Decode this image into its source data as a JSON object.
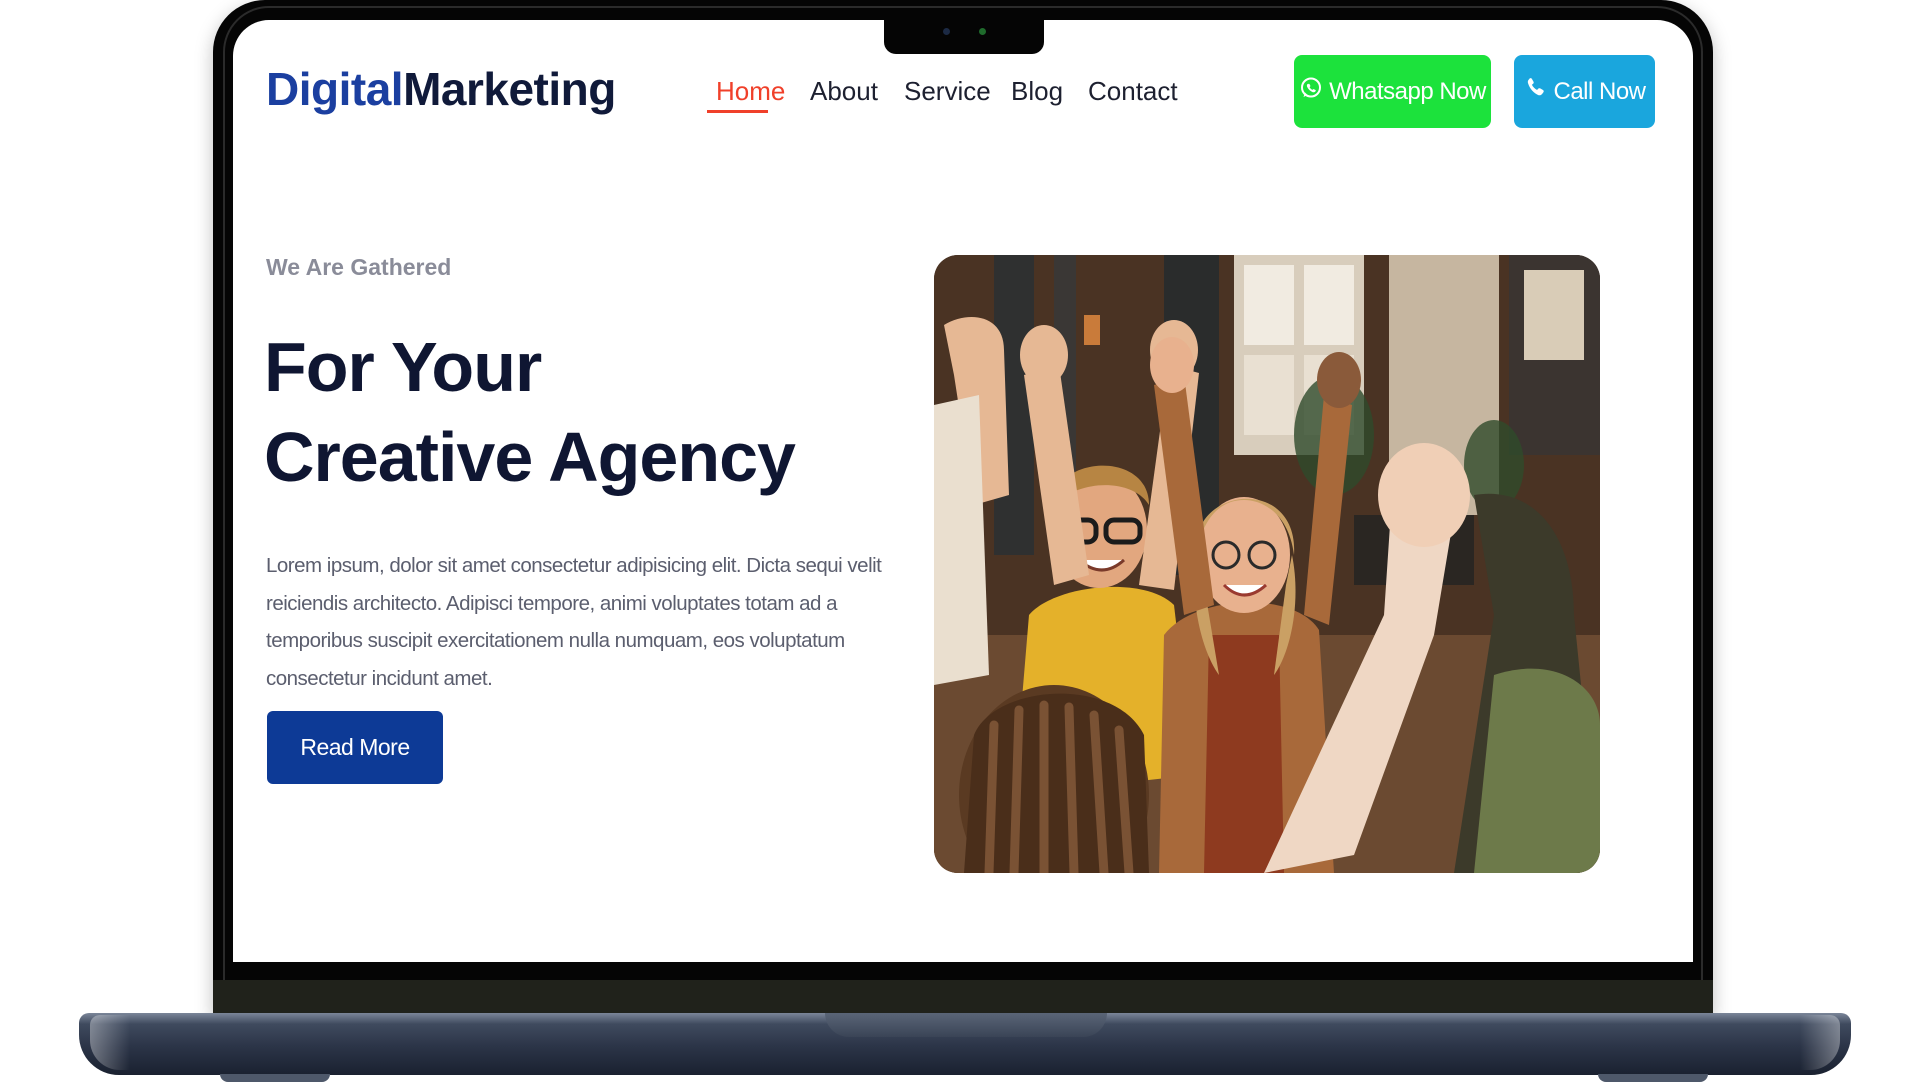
{
  "brand": {
    "part1": "Digital",
    "part2": "Marketing"
  },
  "nav": {
    "items": [
      "Home",
      "About",
      "Service",
      "Blog",
      "Contact"
    ],
    "active": "Home"
  },
  "actions": {
    "whatsapp_label": "Whatsapp Now",
    "call_label": "Call Now"
  },
  "hero": {
    "eyebrow": "We Are Gathered",
    "title_line1": "For Your",
    "title_line2": "Creative Agency",
    "body": "Lorem ipsum, dolor sit amet consectetur adipisicing elit. Dicta sequi velit reiciendis architecto. Adipisci tempore, animi voluptates totam ad a temporibus suscipit exercitationem nulla numquam, eos voluptatum consectetur incidunt amet.",
    "cta_label": "Read More"
  },
  "colors": {
    "accent_nav": "#f0402a",
    "brand_blue": "#1b3fa0",
    "brand_dark": "#101a3a",
    "whatsapp_green": "#1ce23c",
    "call_blue": "#1aa6dd",
    "cta_blue": "#0d3a96"
  },
  "icons": {
    "whatsapp": "whatsapp-icon",
    "phone": "phone-icon"
  }
}
